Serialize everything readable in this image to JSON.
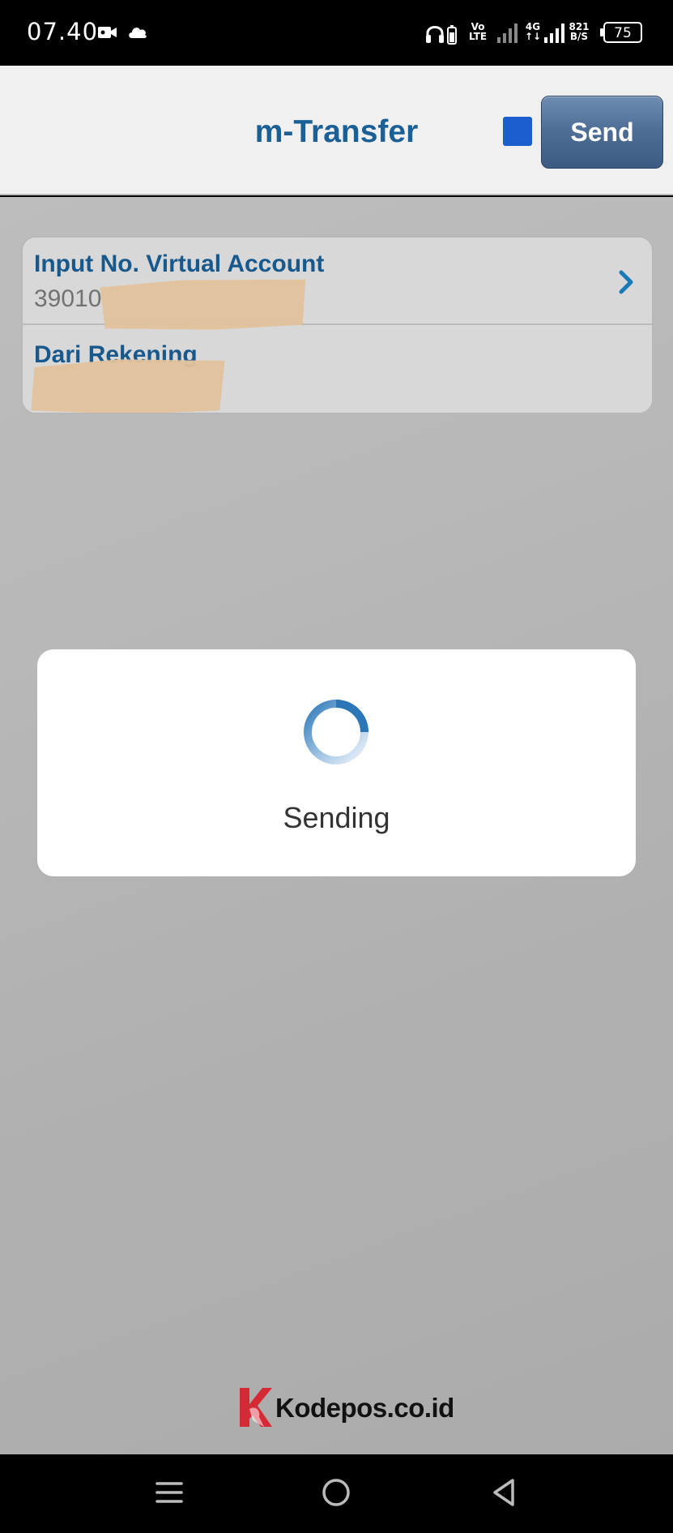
{
  "status_bar": {
    "time": "07.40",
    "volte_top": "Vo",
    "volte_bottom": "LTE",
    "network_type": "4G",
    "speed_value": "821",
    "speed_unit": "B/S",
    "battery_level": "75",
    "icons": [
      "video-camera-icon",
      "cloud-icon",
      "headphones-icon",
      "signal-icon",
      "battery-icon"
    ]
  },
  "header": {
    "title": "m-Transfer",
    "send_label": "Send",
    "accent_color": "#1a5f96"
  },
  "form": {
    "virtual_account": {
      "label": "Input No. Virtual Account",
      "value": "39010"
    },
    "source_account": {
      "label": "Dari Rekening"
    }
  },
  "dialog": {
    "message": "Sending"
  },
  "watermark": {
    "text": "Kodepos.co.id"
  },
  "navbar": {
    "icons": [
      "menu-icon",
      "home-icon",
      "back-icon"
    ]
  }
}
